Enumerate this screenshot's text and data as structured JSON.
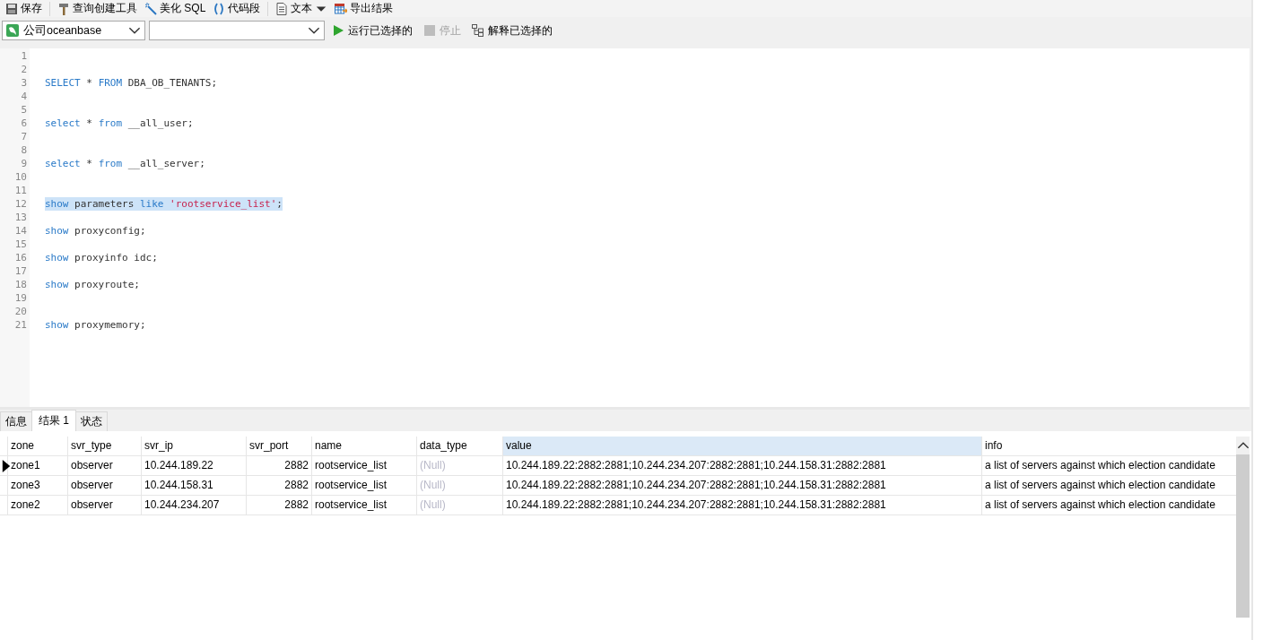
{
  "toolbar": [
    {
      "label": "保存",
      "menu": false
    },
    {
      "label": "查询创建工具",
      "menu": false
    },
    {
      "label": "美化 SQL",
      "menu": false
    },
    {
      "label": "代码段",
      "menu": false
    },
    {
      "label": "文本",
      "menu": true
    },
    {
      "label": "导出结果",
      "menu": false
    }
  ],
  "run_bar": {
    "connection": "公司oceanbase",
    "actions": [
      {
        "label": "运行已选择的",
        "disabled": false
      },
      {
        "label": "停止",
        "disabled": true
      },
      {
        "label": "解释已选择的",
        "disabled": false
      }
    ]
  },
  "editor": {
    "lines": [
      {
        "number": "1"
      },
      {
        "number": "2"
      },
      {
        "number": "3",
        "selected": false,
        "tokens": [
          {
            "kind": "kw",
            "text": "SELECT"
          },
          {
            "kind": "plain",
            "text": " * "
          },
          {
            "kind": "kw",
            "text": "FROM"
          },
          {
            "kind": "plain",
            "text": " DBA_OB_TENANTS;"
          }
        ]
      },
      {
        "number": "4"
      },
      {
        "number": "5"
      },
      {
        "number": "6",
        "selected": false,
        "tokens": [
          {
            "kind": "kw",
            "text": "select"
          },
          {
            "kind": "plain",
            "text": " * "
          },
          {
            "kind": "kw",
            "text": "from"
          },
          {
            "kind": "plain",
            "text": " __all_user;"
          }
        ]
      },
      {
        "number": "7"
      },
      {
        "number": "8"
      },
      {
        "number": "9",
        "selected": false,
        "tokens": [
          {
            "kind": "kw",
            "text": "select"
          },
          {
            "kind": "plain",
            "text": " * "
          },
          {
            "kind": "kw",
            "text": "from"
          },
          {
            "kind": "plain",
            "text": " __all_server;"
          }
        ]
      },
      {
        "number": "10"
      },
      {
        "number": "11"
      },
      {
        "number": "12",
        "selected": true,
        "tokens": [
          {
            "kind": "kw",
            "text": "show"
          },
          {
            "kind": "plain",
            "text": " parameters "
          },
          {
            "kind": "kw",
            "text": "like"
          },
          {
            "kind": "str",
            "text": " 'rootservice_list'"
          },
          {
            "kind": "plain",
            "text": ";"
          }
        ]
      },
      {
        "number": "13"
      },
      {
        "number": "14",
        "selected": false,
        "tokens": [
          {
            "kind": "kw",
            "text": "show"
          },
          {
            "kind": "plain",
            "text": " proxyconfig;"
          }
        ]
      },
      {
        "number": "15"
      },
      {
        "number": "16",
        "selected": false,
        "tokens": [
          {
            "kind": "kw",
            "text": "show"
          },
          {
            "kind": "plain",
            "text": " proxyinfo idc;"
          }
        ]
      },
      {
        "number": "17"
      },
      {
        "number": "18",
        "selected": false,
        "tokens": [
          {
            "kind": "kw",
            "text": "show"
          },
          {
            "kind": "plain",
            "text": " proxyroute;"
          }
        ]
      },
      {
        "number": "19"
      },
      {
        "number": "20"
      },
      {
        "number": "21",
        "selected": false,
        "tokens": [
          {
            "kind": "kw",
            "text": "show"
          },
          {
            "kind": "plain",
            "text": " proxymemory;"
          }
        ]
      }
    ]
  },
  "result_tabs": [
    {
      "label": "信息",
      "selected": false
    },
    {
      "label": "结果 1",
      "selected": true
    },
    {
      "label": "状态",
      "selected": false
    }
  ],
  "table": {
    "columns": [
      {
        "label": "zone",
        "selected": false,
        "kind": "text"
      },
      {
        "label": "svr_type",
        "selected": false,
        "kind": "text"
      },
      {
        "label": "svr_ip",
        "selected": false,
        "kind": "text"
      },
      {
        "label": "svr_port",
        "selected": false,
        "kind": "number"
      },
      {
        "label": "name",
        "selected": false,
        "kind": "text"
      },
      {
        "label": "data_type",
        "selected": false,
        "kind": "null"
      },
      {
        "label": "value",
        "selected": true,
        "kind": "text"
      },
      {
        "label": "info",
        "selected": false,
        "kind": "text"
      }
    ],
    "rows": [
      {
        "current": true,
        "cells": [
          "zone1",
          "observer",
          "10.244.189.22",
          "2882",
          "rootservice_list",
          "(Null)",
          "10.244.189.22:2882:2881;10.244.234.207:2882:2881;10.244.158.31:2882:2881",
          "a list of servers against which election candidate"
        ]
      },
      {
        "current": false,
        "cells": [
          "zone3",
          "observer",
          "10.244.158.31",
          "2882",
          "rootservice_list",
          "(Null)",
          "10.244.189.22:2882:2881;10.244.234.207:2882:2881;10.244.158.31:2882:2881",
          "a list of servers against which election candidate"
        ]
      },
      {
        "current": false,
        "cells": [
          "zone2",
          "observer",
          "10.244.234.207",
          "2882",
          "rootservice_list",
          "(Null)",
          "10.244.189.22:2882:2881;10.244.234.207:2882:2881;10.244.158.31:2882:2881",
          "a list of servers against which election candidate"
        ]
      }
    ]
  }
}
